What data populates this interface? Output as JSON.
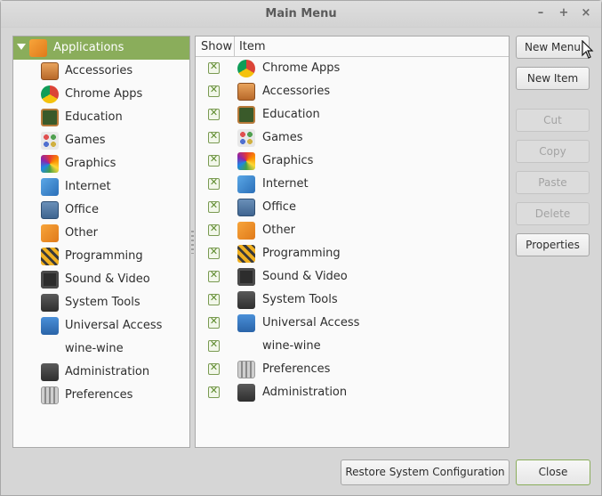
{
  "window": {
    "title": "Main Menu",
    "controls": {
      "minimize": "–",
      "maximize": "+",
      "close": "×"
    }
  },
  "tree": {
    "root": {
      "label": "Applications",
      "icon": "applications-icon"
    },
    "items": [
      {
        "label": "Accessories",
        "icon": "accessories-icon"
      },
      {
        "label": "Chrome Apps",
        "icon": "chrome-icon"
      },
      {
        "label": "Education",
        "icon": "education-icon"
      },
      {
        "label": "Games",
        "icon": "games-icon"
      },
      {
        "label": "Graphics",
        "icon": "graphics-icon"
      },
      {
        "label": "Internet",
        "icon": "internet-icon"
      },
      {
        "label": "Office",
        "icon": "office-icon"
      },
      {
        "label": "Other",
        "icon": "other-icon"
      },
      {
        "label": "Programming",
        "icon": "programming-icon"
      },
      {
        "label": "Sound & Video",
        "icon": "sound-video-icon"
      },
      {
        "label": "System Tools",
        "icon": "system-tools-icon"
      },
      {
        "label": "Universal Access",
        "icon": "universal-access-icon"
      },
      {
        "label": "wine-wine",
        "icon": ""
      },
      {
        "label": "Administration",
        "icon": "administration-icon"
      },
      {
        "label": "Preferences",
        "icon": "preferences-icon"
      }
    ]
  },
  "list": {
    "headers": {
      "show": "Show",
      "item": "Item"
    },
    "check_mark": "✕",
    "items": [
      {
        "label": "Chrome Apps",
        "icon": "chrome-icon",
        "show": true
      },
      {
        "label": "Accessories",
        "icon": "accessories-icon",
        "show": true
      },
      {
        "label": "Education",
        "icon": "education-icon",
        "show": true
      },
      {
        "label": "Games",
        "icon": "games-icon",
        "show": true
      },
      {
        "label": "Graphics",
        "icon": "graphics-icon",
        "show": true
      },
      {
        "label": "Internet",
        "icon": "internet-icon",
        "show": true
      },
      {
        "label": "Office",
        "icon": "office-icon",
        "show": true
      },
      {
        "label": "Other",
        "icon": "other-icon",
        "show": true
      },
      {
        "label": "Programming",
        "icon": "programming-icon",
        "show": true
      },
      {
        "label": "Sound & Video",
        "icon": "sound-video-icon",
        "show": true
      },
      {
        "label": "System Tools",
        "icon": "system-tools-icon",
        "show": true
      },
      {
        "label": "Universal Access",
        "icon": "universal-access-icon",
        "show": true
      },
      {
        "label": "wine-wine",
        "icon": "",
        "show": true
      },
      {
        "label": "Preferences",
        "icon": "preferences-icon",
        "show": true
      },
      {
        "label": "Administration",
        "icon": "administration-icon",
        "show": true
      }
    ]
  },
  "buttons": {
    "new_menu": "New Menu",
    "new_item": "New Item",
    "cut": "Cut",
    "copy": "Copy",
    "paste": "Paste",
    "delete": "Delete",
    "properties": "Properties",
    "restore": "Restore System Configuration",
    "close": "Close"
  },
  "colors": {
    "selection": "#8aad5b",
    "check_border": "#7a9a52"
  }
}
